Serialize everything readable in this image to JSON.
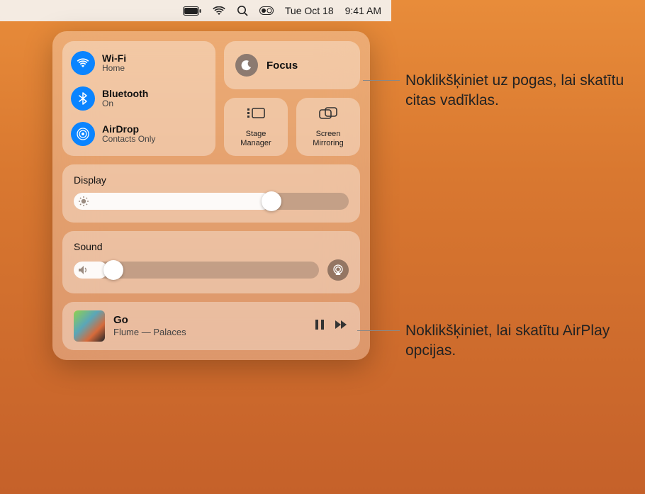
{
  "menubar": {
    "date": "Tue Oct 18",
    "time": "9:41 AM"
  },
  "connectivity": {
    "wifi": {
      "title": "Wi-Fi",
      "sub": "Home"
    },
    "bluetooth": {
      "title": "Bluetooth",
      "sub": "On"
    },
    "airdrop": {
      "title": "AirDrop",
      "sub": "Contacts Only"
    }
  },
  "focus": {
    "label": "Focus"
  },
  "tiles": {
    "stage_manager": "Stage\nManager",
    "screen_mirroring": "Screen\nMirroring"
  },
  "display": {
    "title": "Display",
    "value": 72
  },
  "sound": {
    "title": "Sound",
    "value": 12
  },
  "now_playing": {
    "title": "Go",
    "subtitle": "Flume — Palaces"
  },
  "callouts": {
    "focus": "Noklikšķiniet uz pogas, lai skatītu citas vadīklas.",
    "airplay": "Noklikšķiniet, lai skatītu AirPlay opcijas."
  }
}
